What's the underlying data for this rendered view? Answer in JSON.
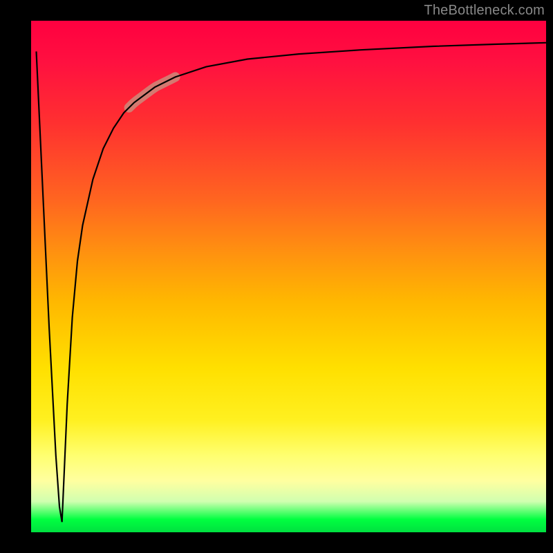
{
  "watermark": "TheBottleneck.com",
  "chart_data": {
    "type": "line",
    "title": "",
    "xlabel": "",
    "ylabel": "",
    "x_range": [
      0,
      100
    ],
    "y_range": [
      0,
      100
    ],
    "annotations": [
      {
        "name": "highlighted-segment",
        "x_start": 19,
        "x_end": 28,
        "note": "salmon highlight on curve"
      }
    ],
    "background_gradient": {
      "direction": "vertical",
      "top_color": "#ff0040",
      "bottom_color": "#00e040",
      "stops": [
        "red",
        "orange",
        "yellow",
        "green"
      ]
    },
    "series": [
      {
        "name": "left-needle",
        "x": [
          1.0,
          3.5,
          4.8,
          5.5,
          6.0
        ],
        "y": [
          94,
          40,
          15,
          5,
          2
        ]
      },
      {
        "name": "main-log-curve",
        "x": [
          6.0,
          7,
          8,
          9,
          10,
          12,
          14,
          16,
          18,
          20,
          24,
          28,
          34,
          42,
          52,
          64,
          78,
          90,
          100
        ],
        "y": [
          2,
          25,
          42,
          53,
          60,
          69,
          75,
          79,
          82,
          84,
          87,
          89,
          91,
          92.5,
          93.5,
          94.3,
          95,
          95.4,
          95.7
        ]
      }
    ]
  },
  "colors": {
    "axis": "#000000",
    "curve": "#000000",
    "highlight": "#cc8a7a",
    "watermark": "#888888"
  }
}
